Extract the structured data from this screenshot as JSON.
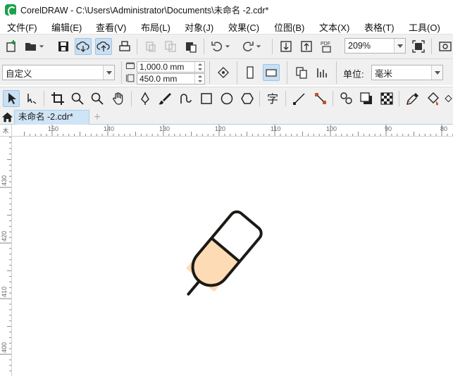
{
  "window": {
    "title": "CorelDRAW - C:\\Users\\Administrator\\Documents\\未命名 -2.cdr*"
  },
  "menu": [
    {
      "label": "文件(F)"
    },
    {
      "label": "编辑(E)"
    },
    {
      "label": "查看(V)"
    },
    {
      "label": "布局(L)"
    },
    {
      "label": "对象(J)"
    },
    {
      "label": "效果(C)"
    },
    {
      "label": "位图(B)"
    },
    {
      "label": "文本(X)"
    },
    {
      "label": "表格(T)"
    },
    {
      "label": "工具(O)"
    }
  ],
  "standard_toolbar": {
    "zoom_value": "209%",
    "icons": [
      "new-document-icon",
      "open-icon",
      "save-icon",
      "cloud-download-icon",
      "cloud-upload-icon",
      "print-icon",
      "cut-icon",
      "copy-icon",
      "paste-icon",
      "undo-icon",
      "redo-icon",
      "import-icon",
      "export-icon",
      "pdf-icon",
      "zoom-to-page-icon",
      "options-icon"
    ]
  },
  "property_bar": {
    "page_preset": "自定义",
    "width": "1,000.0 mm",
    "height": "450.0 mm",
    "units_label": "单位:",
    "units_value": "毫米"
  },
  "toolbox": {
    "icons": [
      "pick-tool-icon",
      "freehand-pick-icon",
      "crop-tool-icon",
      "zoom-tool-icon",
      "zoom-out-icon",
      "pan-tool-icon",
      "pen-tool-icon",
      "artistic-media-icon",
      "smart-drawing-icon",
      "rectangle-tool-icon",
      "ellipse-tool-icon",
      "polygon-tool-icon",
      "text-tool-icon",
      "line-tool-icon",
      "connector-tool-icon",
      "blend-tool-icon",
      "drop-shadow-icon",
      "transparency-icon",
      "eyedropper-icon",
      "fill-tool-icon"
    ]
  },
  "tabs": {
    "document": "未命名 -2.cdr*",
    "add": "+"
  },
  "ruler": {
    "horizontal_labels": [
      "150",
      "140",
      "130",
      "120",
      "110",
      "100",
      "90",
      "80"
    ],
    "vertical_labels": [
      "430",
      "420",
      "410",
      "400"
    ],
    "corner_label": "木"
  },
  "drawing": {
    "name": "capsule-pen",
    "cap_color": "#ffffff",
    "body_color": "#fddbb4",
    "stroke_color": "#1c1a17"
  }
}
